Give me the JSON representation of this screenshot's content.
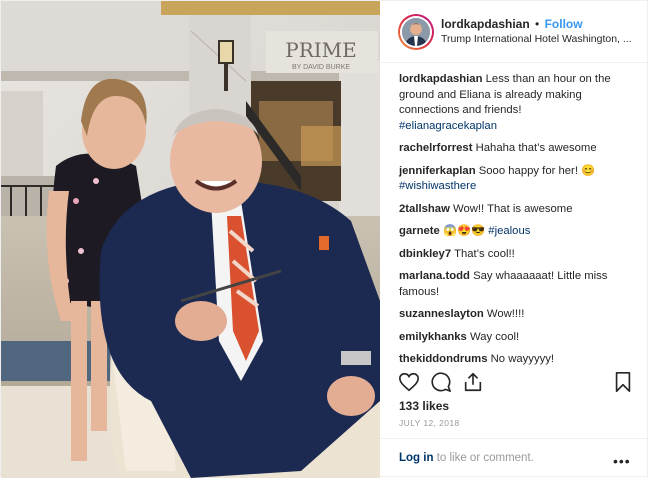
{
  "header": {
    "username": "lordkapdashian",
    "separator": "•",
    "follow_label": "Follow",
    "location": "Trump International Hotel Washington, ..."
  },
  "photo": {
    "sign_title": "PRIME",
    "sign_subtitle": "BY DAVID BURKE"
  },
  "caption": {
    "user": "lordkapdashian",
    "text": "Less than an hour on the ground and Eliana is already making connections and friends!",
    "hashtag": "#elianagracekaplan"
  },
  "comments": [
    {
      "user": "rachelrforrest",
      "text": "Hahaha that’s awesome"
    },
    {
      "user": "jenniferkaplan",
      "text": "Sooo happy for her! 😊",
      "hashtag": "#wishiwasthere"
    },
    {
      "user": "2tallshaw",
      "text": "Wow!! That is awesome"
    },
    {
      "user": "garnete",
      "text": "😱😍😎",
      "hashtag": "#jealous"
    },
    {
      "user": "dbinkley7",
      "text": "That’s cool!!"
    },
    {
      "user": "marlana.todd",
      "text": "Say whaaaaaat! Little miss famous!"
    },
    {
      "user": "suzanneslayton",
      "text": "Wow!!!!"
    },
    {
      "user": "emilykhanks",
      "text": "Way cool!"
    },
    {
      "user": "thekiddondrums",
      "text": "No wayyyyy!"
    }
  ],
  "actions": {
    "icons": [
      "heart-icon",
      "comment-icon",
      "share-icon",
      "bookmark-icon"
    ]
  },
  "likes": "133 likes",
  "date": "JULY 12, 2018",
  "footer": {
    "login_link": "Log in",
    "login_text": " to like or comment.",
    "more_label": "•••"
  }
}
